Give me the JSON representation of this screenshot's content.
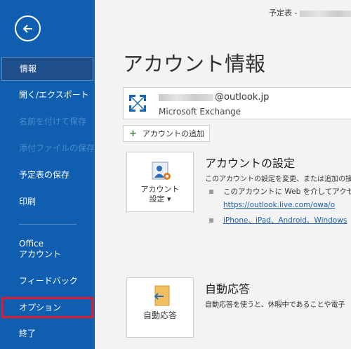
{
  "titlebar": {
    "prefix": "予定表 - "
  },
  "sidebar": {
    "back_icon": "back-arrow-icon",
    "items": [
      {
        "label": "情報"
      },
      {
        "label": "開く/エクスポート"
      },
      {
        "label": "名前を付けて保存"
      },
      {
        "label": "添付ファイルの保存"
      },
      {
        "label": "予定表の保存"
      },
      {
        "label": "印刷"
      },
      {
        "label_line1": "Office",
        "label_line2": "アカウント"
      },
      {
        "label": "フィードバック"
      },
      {
        "label": "オプション"
      },
      {
        "label": "終了"
      }
    ]
  },
  "main": {
    "title": "アカウント情報",
    "account": {
      "email_suffix": "@outlook.jp",
      "type": "Microsoft Exchange"
    },
    "add_account": {
      "label": "アカウントの追加"
    },
    "account_settings": {
      "tile_line1": "アカウント",
      "tile_line2": "設定 ▾",
      "title": "アカウントの設定",
      "desc": "このアカウントの設定を変更、または追加の接",
      "bullet1": "このアカウントに Web を介してアクセスし",
      "link1": "https://outlook.live.com/owa/o",
      "bullet2": "iPhone、iPad、Android、Windows"
    },
    "auto_reply": {
      "tile_label": "自動応答",
      "title": "自動応答",
      "desc": "自動応答を使うと、休暇中であることや電子"
    }
  },
  "colors": {
    "sidebar_bg": "#0f5eb0",
    "selected_bg": "#1f4f8a",
    "highlight_outline": "#e01b2b"
  }
}
